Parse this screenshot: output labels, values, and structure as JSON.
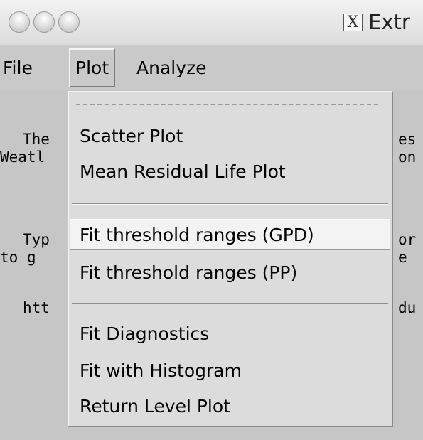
{
  "window": {
    "title": "Extr",
    "close_glyph": "X"
  },
  "menubar": {
    "items": [
      {
        "label": "File"
      },
      {
        "label": "Plot"
      },
      {
        "label": "Analyze"
      }
    ]
  },
  "background_text": {
    "lines": [
      "The",
      "Weatl",
      "Typ",
      "to g",
      "htt",
      "es",
      "on",
      "or",
      "e",
      "du"
    ]
  },
  "dropdown": {
    "groups": [
      [
        "Scatter Plot",
        "Mean Residual Life Plot"
      ],
      [
        "Fit threshold ranges (GPD)",
        "Fit threshold ranges (PP)"
      ],
      [
        "Fit Diagnostics",
        "Fit with Histogram",
        "Return Level Plot"
      ]
    ],
    "active_item": "Fit threshold ranges (GPD)"
  },
  "icons": [
    "traffic-light-icon",
    "x11-icon",
    "tearoff-line"
  ]
}
